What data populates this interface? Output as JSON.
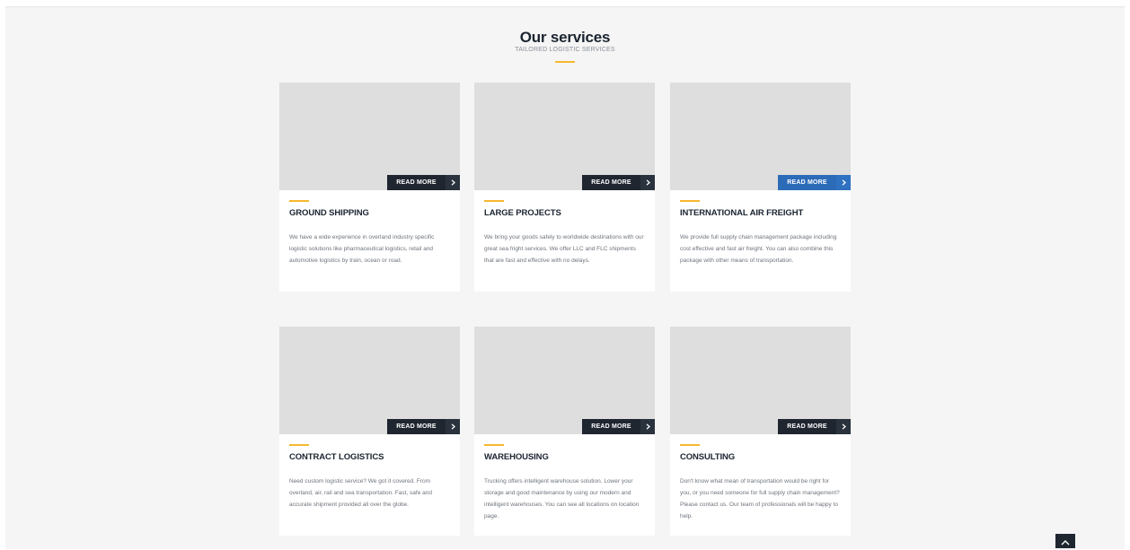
{
  "section": {
    "title": "Our services",
    "subtitle": "TAILORED LOGISTIC SERVICES"
  },
  "colors": {
    "accent": "#f5b82e",
    "dark_button": "#1f2630",
    "active_button": "#2c6bb8",
    "card_placeholder": "#dedede",
    "page_background": "#f5f5f5"
  },
  "services": [
    {
      "title": "GROUND SHIPPING",
      "text": "We have a wide experience in overland industry specific logistic solutions like pharmaceutical logistics, retail and automotive logistics by train, ocean or road.",
      "read_more": "READ MORE",
      "read_more_icon": "chevron-right-icon",
      "highlighted": false
    },
    {
      "title": "LARGE PROJECTS",
      "text": "We bring your goods safely to worldwide destinations with our great sea fright services. We offer LLC and FLC shipments that are fast and effective with no delays.",
      "read_more": "READ MORE",
      "read_more_icon": "chevron-right-icon",
      "highlighted": false
    },
    {
      "title": "INTERNATIONAL AIR FREIGHT",
      "text": "We provide full supply chain management package including cost effective and fast air freight. You can also combine this package with other means of transportation.",
      "read_more": "READ MORE",
      "read_more_icon": "chevron-right-icon",
      "highlighted": true
    },
    {
      "title": "CONTRACT LOGISTICS",
      "text": "Need custom logistic service? We got it covered. From overland, air, rail and sea transportation. Fast, safe and accurate shipment provided all over the globe.",
      "read_more": "READ MORE",
      "read_more_icon": "chevron-right-icon",
      "highlighted": false
    },
    {
      "title": "WAREHOUSING",
      "text": "Trucking offers intelligent warehouse solution. Lower your storage and good maintenance by using our modern and intelligent warehouses. You can see all locations on location page.",
      "read_more": "READ MORE",
      "read_more_icon": "chevron-right-icon",
      "highlighted": false
    },
    {
      "title": "CONSULTING",
      "text": "Don't know what mean of transportation would be right for you, or you need someone for full supply chain management? Please contact us. Our team of professionals will be happy to help.",
      "read_more": "READ MORE",
      "read_more_icon": "chevron-right-icon",
      "highlighted": false
    }
  ],
  "back_to_top": {
    "icon": "chevron-up-icon"
  }
}
